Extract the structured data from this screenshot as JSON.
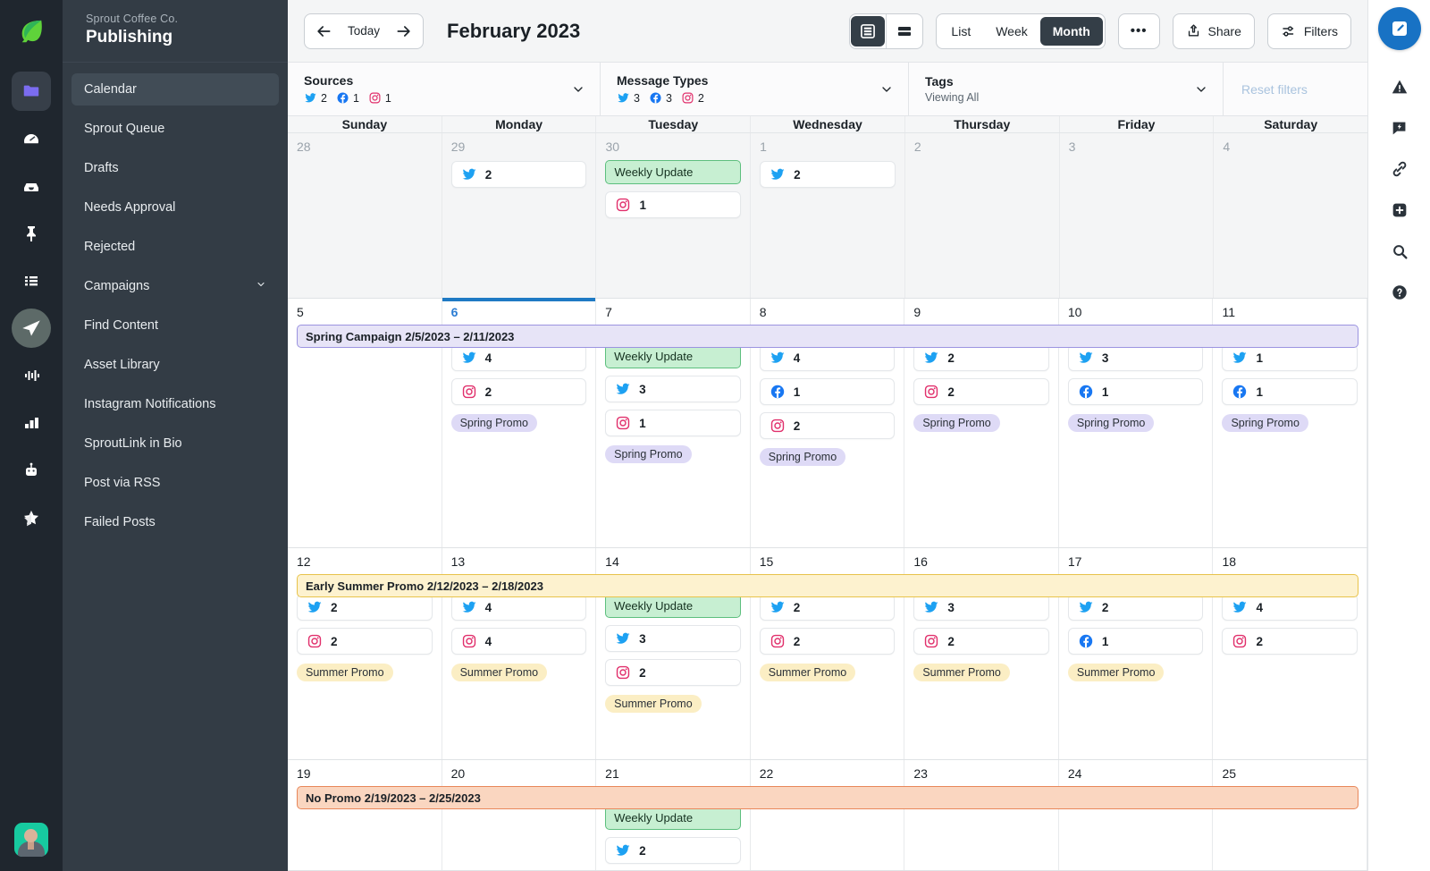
{
  "brand": {
    "logo": "sprout-leaf-logo",
    "accent": "#1872c4"
  },
  "icon_rail": {
    "items": [
      {
        "name": "folder-icon",
        "active": true
      },
      {
        "name": "dashboard-gauge-icon",
        "active": false
      },
      {
        "name": "inbox-icon",
        "active": false
      },
      {
        "name": "pin-icon",
        "active": false
      },
      {
        "name": "list-icon",
        "active": false
      },
      {
        "name": "publishing-send-icon",
        "active": true
      },
      {
        "name": "listening-waveform-icon",
        "active": false
      },
      {
        "name": "reports-bars-icon",
        "active": false
      },
      {
        "name": "bot-icon",
        "active": false
      },
      {
        "name": "star-icon",
        "active": false
      }
    ],
    "avatar": "user-avatar"
  },
  "sidebar": {
    "company": "Sprout Coffee Co.",
    "title": "Publishing",
    "items": [
      {
        "label": "Calendar",
        "active": true,
        "expandable": false
      },
      {
        "label": "Sprout Queue",
        "active": false,
        "expandable": false
      },
      {
        "label": "Drafts",
        "active": false,
        "expandable": false
      },
      {
        "label": "Needs Approval",
        "active": false,
        "expandable": false
      },
      {
        "label": "Rejected",
        "active": false,
        "expandable": false
      },
      {
        "label": "Campaigns",
        "active": false,
        "expandable": true
      },
      {
        "label": "Find Content",
        "active": false,
        "expandable": false
      },
      {
        "label": "Asset Library",
        "active": false,
        "expandable": false
      },
      {
        "label": "Instagram Notifications",
        "active": false,
        "expandable": false
      },
      {
        "label": "SproutLink in Bio",
        "active": false,
        "expandable": false
      },
      {
        "label": "Post via RSS",
        "active": false,
        "expandable": false
      },
      {
        "label": "Failed Posts",
        "active": false,
        "expandable": false
      }
    ]
  },
  "toolbar": {
    "prev_label": "previous-period",
    "today_label": "Today",
    "next_label": "next-period",
    "month_title": "February 2023",
    "density": [
      {
        "name": "density-comfortable",
        "active": true
      },
      {
        "name": "density-compact",
        "active": false
      }
    ],
    "views": [
      {
        "label": "List",
        "active": false
      },
      {
        "label": "Week",
        "active": false
      },
      {
        "label": "Month",
        "active": true
      }
    ],
    "more_label": "•••",
    "share_label": "Share",
    "filters_label": "Filters"
  },
  "filters": {
    "sources": {
      "label": "Sources",
      "counts": [
        {
          "network": "twitter",
          "value": "2"
        },
        {
          "network": "facebook",
          "value": "1"
        },
        {
          "network": "instagram",
          "value": "1"
        }
      ]
    },
    "message_types": {
      "label": "Message Types",
      "counts": [
        {
          "network": "twitter",
          "value": "3"
        },
        {
          "network": "facebook",
          "value": "3"
        },
        {
          "network": "instagram",
          "value": "2"
        }
      ]
    },
    "tags": {
      "label": "Tags",
      "sub": "Viewing All"
    },
    "reset_label": "Reset filters"
  },
  "calendar": {
    "day_headers": [
      "Sunday",
      "Monday",
      "Tuesday",
      "Wednesday",
      "Thursday",
      "Friday",
      "Saturday"
    ],
    "weeks": [
      {
        "campaign": null,
        "days": [
          {
            "num": "28",
            "outside": true,
            "today": false,
            "update": null,
            "counts": [],
            "tag": null
          },
          {
            "num": "29",
            "outside": true,
            "today": false,
            "update": null,
            "counts": [
              {
                "network": "twitter",
                "value": "2"
              }
            ],
            "tag": null
          },
          {
            "num": "30",
            "outside": true,
            "today": false,
            "update": "Weekly Update",
            "counts": [
              {
                "network": "instagram",
                "value": "1"
              }
            ],
            "tag": null
          },
          {
            "num": "1",
            "outside": true,
            "today": false,
            "update": null,
            "counts": [
              {
                "network": "twitter",
                "value": "2"
              }
            ],
            "tag": null
          },
          {
            "num": "2",
            "outside": true,
            "today": false,
            "update": null,
            "counts": [],
            "tag": null
          },
          {
            "num": "3",
            "outside": true,
            "today": false,
            "update": null,
            "counts": [],
            "tag": null
          },
          {
            "num": "4",
            "outside": true,
            "today": false,
            "update": null,
            "counts": [],
            "tag": null
          }
        ]
      },
      {
        "campaign": {
          "label": "Spring Campaign 2/5/2023 – 2/11/2023",
          "color": "purple"
        },
        "days": [
          {
            "num": "5",
            "outside": false,
            "today": false,
            "update": null,
            "counts": [],
            "tag": null
          },
          {
            "num": "6",
            "outside": false,
            "today": true,
            "update": null,
            "counts": [
              {
                "network": "twitter",
                "value": "4"
              },
              {
                "network": "instagram",
                "value": "2"
              }
            ],
            "tag": {
              "label": "Spring Promo",
              "color": "spring"
            }
          },
          {
            "num": "7",
            "outside": false,
            "today": false,
            "update": "Weekly Update",
            "counts": [
              {
                "network": "twitter",
                "value": "3"
              },
              {
                "network": "instagram",
                "value": "1"
              }
            ],
            "tag": {
              "label": "Spring Promo",
              "color": "spring"
            }
          },
          {
            "num": "8",
            "outside": false,
            "today": false,
            "update": null,
            "counts": [
              {
                "network": "twitter",
                "value": "4"
              },
              {
                "network": "facebook",
                "value": "1"
              },
              {
                "network": "instagram",
                "value": "2"
              }
            ],
            "tag": {
              "label": "Spring Promo",
              "color": "spring"
            }
          },
          {
            "num": "9",
            "outside": false,
            "today": false,
            "update": null,
            "counts": [
              {
                "network": "twitter",
                "value": "2"
              },
              {
                "network": "instagram",
                "value": "2"
              }
            ],
            "tag": {
              "label": "Spring Promo",
              "color": "spring"
            }
          },
          {
            "num": "10",
            "outside": false,
            "today": false,
            "update": null,
            "counts": [
              {
                "network": "twitter",
                "value": "3"
              },
              {
                "network": "facebook",
                "value": "1"
              }
            ],
            "tag": {
              "label": "Spring Promo",
              "color": "spring"
            }
          },
          {
            "num": "11",
            "outside": false,
            "today": false,
            "update": null,
            "counts": [
              {
                "network": "twitter",
                "value": "1"
              },
              {
                "network": "facebook",
                "value": "1"
              }
            ],
            "tag": {
              "label": "Spring Promo",
              "color": "spring"
            }
          }
        ]
      },
      {
        "campaign": {
          "label": "Early Summer Promo 2/12/2023 – 2/18/2023",
          "color": "yellow"
        },
        "days": [
          {
            "num": "12",
            "outside": false,
            "today": false,
            "update": null,
            "counts": [
              {
                "network": "twitter",
                "value": "2"
              },
              {
                "network": "instagram",
                "value": "2"
              }
            ],
            "tag": {
              "label": "Summer Promo",
              "color": "summer"
            }
          },
          {
            "num": "13",
            "outside": false,
            "today": false,
            "update": null,
            "counts": [
              {
                "network": "twitter",
                "value": "4"
              },
              {
                "network": "instagram",
                "value": "4"
              }
            ],
            "tag": {
              "label": "Summer Promo",
              "color": "summer"
            }
          },
          {
            "num": "14",
            "outside": false,
            "today": false,
            "update": "Weekly Update",
            "counts": [
              {
                "network": "twitter",
                "value": "3"
              },
              {
                "network": "instagram",
                "value": "2"
              }
            ],
            "tag": {
              "label": "Summer Promo",
              "color": "summer"
            }
          },
          {
            "num": "15",
            "outside": false,
            "today": false,
            "update": null,
            "counts": [
              {
                "network": "twitter",
                "value": "2"
              },
              {
                "network": "instagram",
                "value": "2"
              }
            ],
            "tag": {
              "label": "Summer Promo",
              "color": "summer"
            }
          },
          {
            "num": "16",
            "outside": false,
            "today": false,
            "update": null,
            "counts": [
              {
                "network": "twitter",
                "value": "3"
              },
              {
                "network": "instagram",
                "value": "2"
              }
            ],
            "tag": {
              "label": "Summer Promo",
              "color": "summer"
            }
          },
          {
            "num": "17",
            "outside": false,
            "today": false,
            "update": null,
            "counts": [
              {
                "network": "twitter",
                "value": "2"
              },
              {
                "network": "facebook",
                "value": "1"
              }
            ],
            "tag": {
              "label": "Summer Promo",
              "color": "summer"
            }
          },
          {
            "num": "18",
            "outside": false,
            "today": false,
            "update": null,
            "counts": [
              {
                "network": "twitter",
                "value": "4"
              },
              {
                "network": "instagram",
                "value": "2"
              }
            ],
            "tag": null
          }
        ]
      },
      {
        "campaign": {
          "label": "No Promo 2/19/2023 – 2/25/2023",
          "color": "orange"
        },
        "days": [
          {
            "num": "19",
            "outside": false,
            "today": false,
            "update": null,
            "counts": [],
            "tag": null
          },
          {
            "num": "20",
            "outside": false,
            "today": false,
            "update": null,
            "counts": [],
            "tag": null
          },
          {
            "num": "21",
            "outside": false,
            "today": false,
            "update": "Weekly Update",
            "counts": [
              {
                "network": "twitter",
                "value": "2"
              }
            ],
            "tag": null
          },
          {
            "num": "22",
            "outside": false,
            "today": false,
            "update": null,
            "counts": [],
            "tag": null
          },
          {
            "num": "23",
            "outside": false,
            "today": false,
            "update": null,
            "counts": [],
            "tag": null
          },
          {
            "num": "24",
            "outside": false,
            "today": false,
            "update": null,
            "counts": [],
            "tag": null
          },
          {
            "num": "25",
            "outside": false,
            "today": false,
            "update": null,
            "counts": [],
            "tag": null
          }
        ]
      }
    ]
  },
  "right_rail": {
    "compose": "compose-icon",
    "items": [
      "alert-triangle-icon",
      "lightning-message-icon",
      "link-icon",
      "plus-square-icon",
      "search-icon",
      "help-icon"
    ]
  }
}
